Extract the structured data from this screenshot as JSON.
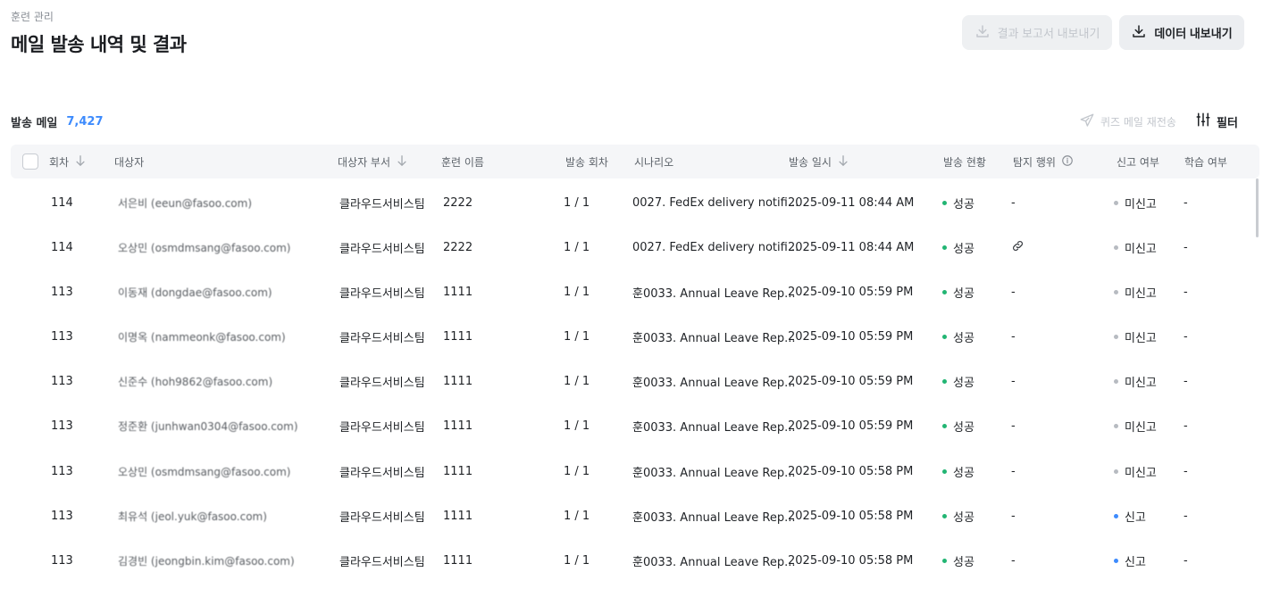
{
  "header": {
    "breadcrumb": "훈련 관리",
    "title": "메일 발송 내역 및 결과",
    "report_export_label": "결과 보고서 내보내기",
    "data_export_label": "데이터 내보내기"
  },
  "summary": {
    "sent_label": "발송 메일",
    "sent_count": "7,427"
  },
  "toolbar": {
    "quiz_resend_label": "퀴즈 메일 재전송",
    "filter_label": "필터"
  },
  "table": {
    "columns": {
      "round": "회차",
      "target": "대상자",
      "dept": "대상자 부서",
      "training": "훈련 이름",
      "send_round": "발송 회차",
      "scenario": "시나리오",
      "sent_at": "발송 일시",
      "status": "발송 현황",
      "detect": "탐지 행위",
      "report": "신고 여부",
      "learn": "학습 여부"
    },
    "rows": [
      {
        "round": "114",
        "target": "서은비 (eeun@fasoo.com)",
        "dept": "클라우드서비스팀",
        "training": "2222",
        "send_round": "1 / 1",
        "scenario": "0027. FedEx delivery notifi...",
        "sent_at": "2025-09-11 08:44 AM",
        "status": "성공",
        "detect": "-",
        "report": "미신고",
        "learn": "-"
      },
      {
        "round": "114",
        "target": "오상민 (osmdmsang@fasoo.com)",
        "dept": "클라우드서비스팀",
        "training": "2222",
        "send_round": "1 / 1",
        "scenario": "0027. FedEx delivery notifi...",
        "sent_at": "2025-09-11 08:44 AM",
        "status": "성공",
        "detect": "",
        "report": "미신고",
        "learn": "-"
      },
      {
        "round": "113",
        "target": "이동재 (dongdae@fasoo.com)",
        "dept": "클라우드서비스팀",
        "training": "1111",
        "send_round": "1 / 1",
        "scenario": "훈0033. Annual Leave Rep...",
        "sent_at": "2025-09-10 05:59 PM",
        "status": "성공",
        "detect": "-",
        "report": "미신고",
        "learn": "-"
      },
      {
        "round": "113",
        "target": "이명옥 (nammeonk@fasoo.com)",
        "dept": "클라우드서비스팀",
        "training": "1111",
        "send_round": "1 / 1",
        "scenario": "훈0033. Annual Leave Rep...",
        "sent_at": "2025-09-10 05:59 PM",
        "status": "성공",
        "detect": "-",
        "report": "미신고",
        "learn": "-"
      },
      {
        "round": "113",
        "target": "신준수 (hoh9862@fasoo.com)",
        "dept": "클라우드서비스팀",
        "training": "1111",
        "send_round": "1 / 1",
        "scenario": "훈0033. Annual Leave Rep...",
        "sent_at": "2025-09-10 05:59 PM",
        "status": "성공",
        "detect": "-",
        "report": "미신고",
        "learn": "-"
      },
      {
        "round": "113",
        "target": "정준환 (junhwan0304@fasoo.com)",
        "dept": "클라우드서비스팀",
        "training": "1111",
        "send_round": "1 / 1",
        "scenario": "훈0033. Annual Leave Rep...",
        "sent_at": "2025-09-10 05:59 PM",
        "status": "성공",
        "detect": "-",
        "report": "미신고",
        "learn": "-"
      },
      {
        "round": "113",
        "target": "오상민 (osmdmsang@fasoo.com)",
        "dept": "클라우드서비스팀",
        "training": "1111",
        "send_round": "1 / 1",
        "scenario": "훈0033. Annual Leave Rep...",
        "sent_at": "2025-09-10 05:58 PM",
        "status": "성공",
        "detect": "-",
        "report": "미신고",
        "learn": "-"
      },
      {
        "round": "113",
        "target": "최유석 (jeol.yuk@fasoo.com)",
        "dept": "클라우드서비스팀",
        "training": "1111",
        "send_round": "1 / 1",
        "scenario": "훈0033. Annual Leave Rep...",
        "sent_at": "2025-09-10 05:58 PM",
        "status": "성공",
        "detect": "-",
        "report": "신고",
        "learn": "-"
      },
      {
        "round": "113",
        "target": "김경빈 (jeongbin.kim@fasoo.com)",
        "dept": "클라우드서비스팀",
        "training": "1111",
        "send_round": "1 / 1",
        "scenario": "훈0033. Annual Leave Rep...",
        "sent_at": "2025-09-10 05:58 PM",
        "status": "성공",
        "detect": "-",
        "report": "신고",
        "learn": "-"
      }
    ]
  },
  "colors": {
    "accent": "#3d8bfd",
    "success": "#22b573",
    "neutral": "#b7bbc1"
  },
  "icons": {
    "export": "download-icon",
    "send": "paper-plane-icon",
    "filter": "sliders-icon",
    "sort": "arrow-down-icon",
    "info": "info-icon",
    "link": "link-icon"
  }
}
